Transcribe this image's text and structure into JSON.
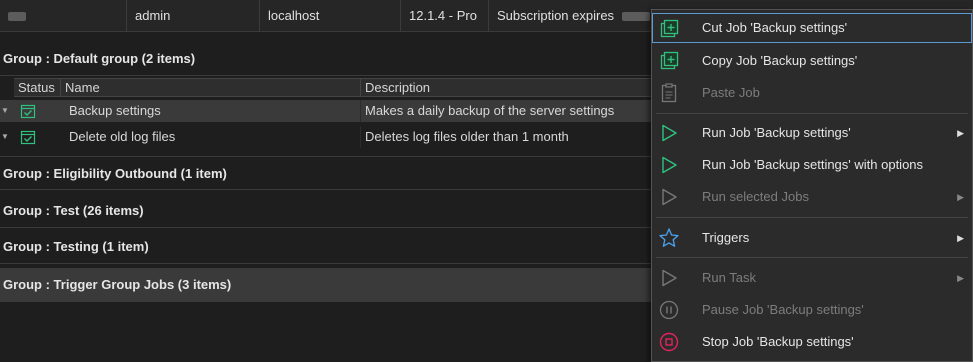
{
  "topbar": {
    "user": "admin",
    "host": "localhost",
    "version": "12.1.4 - Pro",
    "subscription": "Subscription expires"
  },
  "groups": [
    {
      "label": "Group : Default group (2 items)"
    },
    {
      "label": "Group : Eligibility Outbound (1 item)"
    },
    {
      "label": "Group : Test (26 items)"
    },
    {
      "label": "Group : Testing (1 item)"
    },
    {
      "label": "Group : Trigger Group Jobs (3 items)"
    }
  ],
  "table": {
    "columns": [
      "Status",
      "Name",
      "Description"
    ],
    "rows": [
      {
        "name": "Backup settings",
        "description": "Makes a daily backup of the server settings"
      },
      {
        "name": "Delete old log files",
        "description": "Deletes log files older than 1 month"
      }
    ]
  },
  "context_menu": {
    "items": [
      {
        "label": "Cut Job 'Backup settings'",
        "icon": "cut-icon",
        "enabled": true
      },
      {
        "label": "Copy Job 'Backup settings'",
        "icon": "copy-icon",
        "enabled": true
      },
      {
        "label": "Paste Job",
        "icon": "paste-icon",
        "enabled": false
      },
      {
        "label": "Run Job 'Backup settings'",
        "icon": "play-icon",
        "enabled": true,
        "submenu": true
      },
      {
        "label": "Run Job 'Backup settings' with options",
        "icon": "play-icon",
        "enabled": true
      },
      {
        "label": "Run selected Jobs",
        "icon": "play-icon",
        "enabled": false,
        "submenu": true
      },
      {
        "label": "Triggers",
        "icon": "star-icon",
        "enabled": true,
        "submenu": true
      },
      {
        "label": "Run Task",
        "icon": "play-icon",
        "enabled": false,
        "submenu": true
      },
      {
        "label": "Pause Job 'Backup settings'",
        "icon": "pause-icon",
        "enabled": false
      },
      {
        "label": "Stop Job 'Backup settings'",
        "icon": "stop-icon",
        "enabled": true
      }
    ]
  },
  "colors": {
    "background": "#1e1e1e",
    "selection": "#3a3a3a",
    "accent_green": "#2ec27e",
    "accent_blue": "#4aa3f0",
    "stop_red": "#e0245e",
    "focus_outline": "#5a9bd5"
  }
}
